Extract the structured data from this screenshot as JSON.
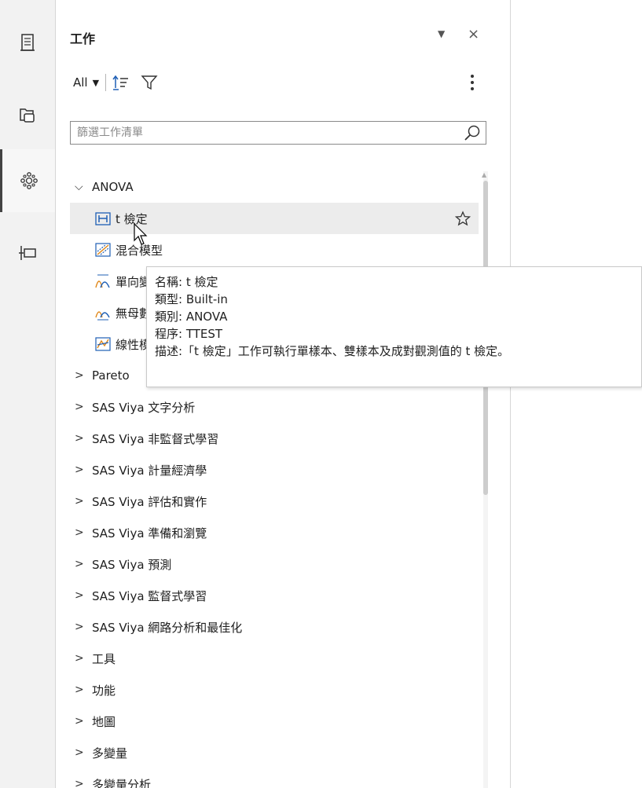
{
  "rail": {
    "items": [
      {
        "name": "document-icon",
        "active": false
      },
      {
        "name": "folders-icon",
        "active": false
      },
      {
        "name": "tasks-icon",
        "active": true
      },
      {
        "name": "snippets-icon",
        "active": false
      }
    ]
  },
  "panel": {
    "title": "工作",
    "toolbar": {
      "view_select": "All"
    },
    "filter": {
      "placeholder": "篩選工作清單",
      "value": ""
    }
  },
  "tree": {
    "groups": [
      {
        "label": "ANOVA",
        "expanded": true,
        "children": [
          {
            "label": "t 檢定",
            "selected": true,
            "favorite": false
          },
          {
            "label": "混合模型"
          },
          {
            "label": "單向變異數分析"
          },
          {
            "label": "無母數單向變異數分析"
          },
          {
            "label": "線性模型"
          }
        ]
      },
      {
        "label": "Pareto"
      },
      {
        "label": "SAS Viya 文字分析"
      },
      {
        "label": "SAS Viya 非監督式學習"
      },
      {
        "label": "SAS Viya 計量經濟學"
      },
      {
        "label": "SAS Viya 評估和實作"
      },
      {
        "label": "SAS Viya 準備和瀏覽"
      },
      {
        "label": "SAS Viya 預測"
      },
      {
        "label": "SAS Viya 監督式學習"
      },
      {
        "label": "SAS Viya 網路分析和最佳化"
      },
      {
        "label": "工具"
      },
      {
        "label": "功能"
      },
      {
        "label": "地圖"
      },
      {
        "label": "多變量"
      },
      {
        "label": "多變量分析"
      }
    ]
  },
  "tooltip": {
    "lines": [
      "名稱: t 檢定",
      "類型: Built-in",
      "類別: ANOVA",
      "程序: TTEST",
      "描述:「t 檢定」工作可執行單樣本、雙樣本及成對觀測值的 t 檢定。"
    ]
  },
  "colors": {
    "rail_bg": "#f2f2f2",
    "selected_row": "#ececec",
    "task_icon_blue": "#1f5fb5",
    "task_icon_orange": "#e0881a"
  }
}
